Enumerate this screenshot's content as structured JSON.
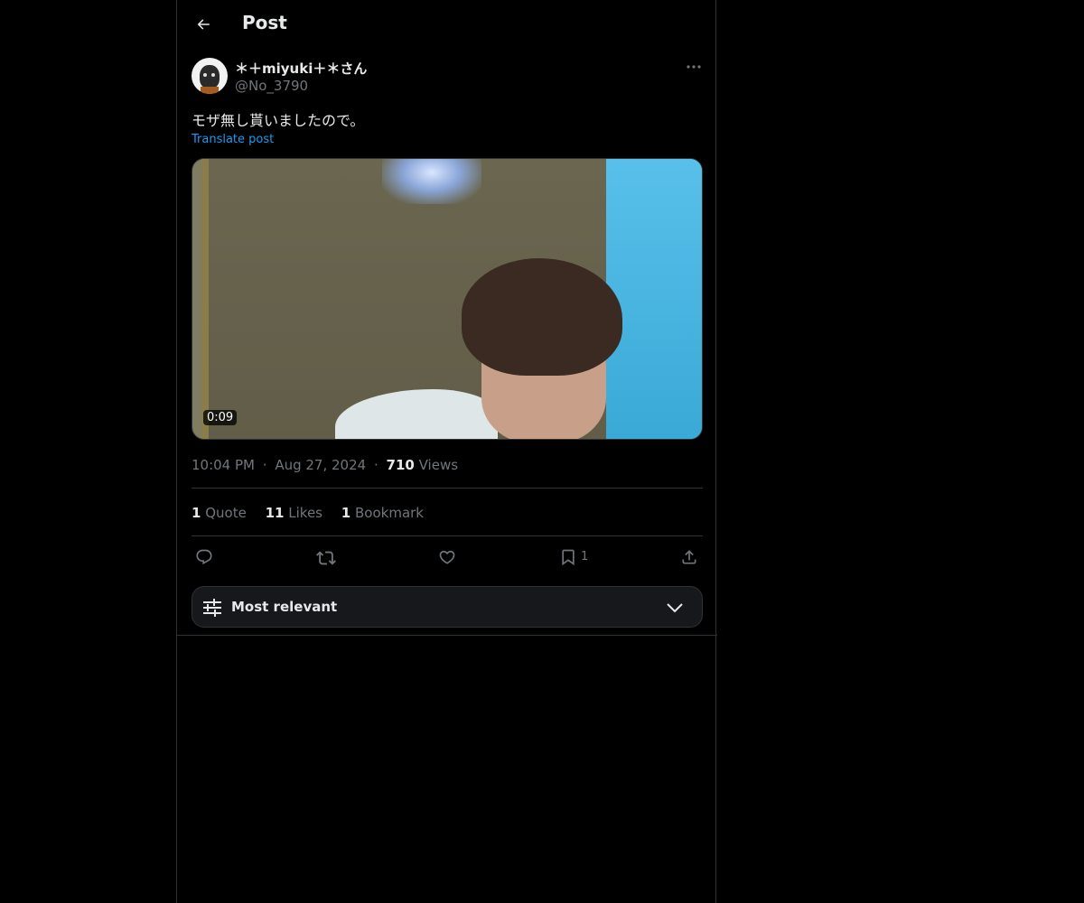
{
  "header": {
    "title": "Post",
    "back_icon": "arrow-left-icon"
  },
  "post": {
    "display_name": "＊＋miyuki＋＊さん",
    "handle": "@No_3790",
    "text": "モザ無し貰いましたので。",
    "translate_label": "Translate post",
    "media": {
      "duration": "0:09"
    },
    "meta": {
      "time": "10:04 PM",
      "separator": "·",
      "date": "Aug 27, 2024",
      "views_count": "710",
      "views_label": "Views"
    },
    "stats": {
      "quotes_count": "1",
      "quotes_label": "Quote",
      "likes_count": "11",
      "likes_label": "Likes",
      "bookmarks_count": "1",
      "bookmarks_label": "Bookmark"
    },
    "actions": {
      "bookmark_count": "1"
    }
  },
  "sort": {
    "label": "Most relevant"
  },
  "colors": {
    "background": "#000000",
    "text_primary": "#e7e9ea",
    "text_secondary": "#71767b",
    "accent": "#1d9bf0",
    "border": "#2f3336"
  }
}
